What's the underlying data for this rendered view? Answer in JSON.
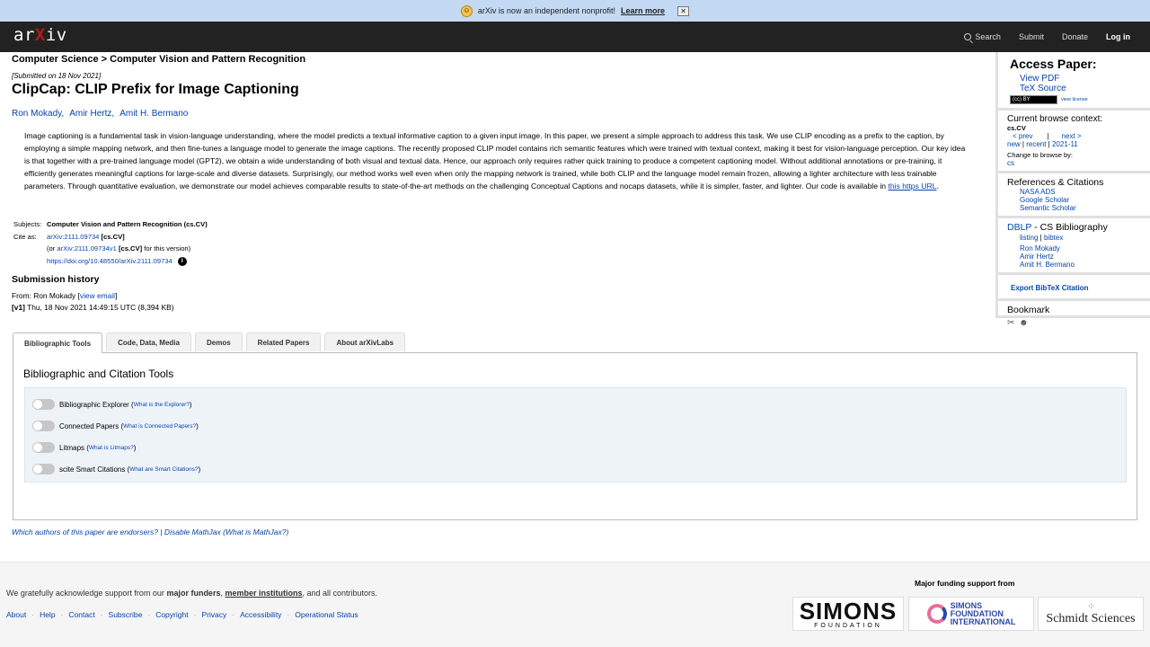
{
  "banner": {
    "text": "arXiv is now an independent nonprofit!",
    "link": "Learn more",
    "close": "✕"
  },
  "header": {
    "logo_pre": "ar",
    "logo_x": "X",
    "logo_post": "iv",
    "nav": {
      "search": "Search",
      "submit": "Submit",
      "donate": "Donate",
      "login": "Log in"
    }
  },
  "paper": {
    "breadcrumb": "Computer Science > Computer Vision and Pattern Recognition",
    "submitted": "[Submitted on 18 Nov 2021]",
    "title": "ClipCap: CLIP Prefix for Image Captioning",
    "authors": [
      "Ron Mokady,",
      "Amir Hertz,",
      "Amit H. Bermano"
    ],
    "abstract": "Image captioning is a fundamental task in vision-language understanding, where the model predicts a textual informative caption to a given input image. In this paper, we present a simple approach to address this task. We use CLIP encoding as a prefix to the caption, by employing a simple mapping network, and then fine-tunes a language model to generate the image captions. The recently proposed CLIP model contains rich semantic features which were trained with textual context, making it best for vision-language perception. Our key idea is that together with a pre-trained language model (GPT2), we obtain a wide understanding of both visual and textual data. Hence, our approach only requires rather quick training to produce a competent captioning model. Without additional annotations or pre-training, it efficiently generates meaningful captions for large-scale and diverse datasets. Surprisingly, our method works well even when only the mapping network is trained, while both CLIP and the language model remain frozen, allowing a lighter architecture with less trainable parameters. Through quantitative evaluation, we demonstrate our model achieves comparable results to state-of-the-art methods on the challenging Conceptual Captions and nocaps datasets, while it is simpler, faster, and lighter. Our code is available in",
    "abstract_link": "this https URL",
    "abstract_end": "."
  },
  "meta": {
    "subjects_label": "Subjects:",
    "subjects_value": "Computer Vision and Pattern Recognition (cs.CV)",
    "cite_label": "Cite as:",
    "cite_id": "arXiv:2111.09734",
    "cite_cat": "[cs.CV]",
    "version_pre": "(or",
    "version_id": "arXiv:2111.09734v1",
    "version_cat": "[cs.CV]",
    "version_post": "for this version)",
    "doi": "https://doi.org/10.48550/arXiv.2111.09734",
    "info": "i"
  },
  "history": {
    "heading": "Submission history",
    "from_label": "From: Ron Mokady [",
    "view_email": "view email",
    "from_end": "]",
    "version": "[v1]",
    "version_text": "Thu, 18 Nov 2021 14:49:15 UTC (8,394 KB)"
  },
  "sidebar": {
    "access_title": "Access Paper:",
    "view_pdf": "View PDF",
    "tex_source": "TeX Source",
    "cc_badge": "(cc) BY",
    "view_license": "view license",
    "context_title": "Current browse context:",
    "context_value": "cs.CV",
    "prev": "< prev",
    "sep": "|",
    "next": "next >",
    "new": "new",
    "recent": "recent",
    "month": "2021-11",
    "change_label": "Change to browse by:",
    "change_value": "cs",
    "refs_title": "References & Citations",
    "refs": [
      "NASA ADS",
      "Google Scholar",
      "Semantic Scholar"
    ],
    "dblp_link": "DBLP",
    "dblp_title": "- CS Bibliography",
    "listing": "listing",
    "bibtex": "bibtex",
    "dblp_authors": [
      "Ron Mokady",
      "Amir Hertz",
      "Amit H. Bermano"
    ],
    "export": "Export BibTeX Citation",
    "bookmark": "Bookmark"
  },
  "tabs": [
    "Bibliographic Tools",
    "Code, Data, Media",
    "Demos",
    "Related Papers",
    "About arXivLabs"
  ],
  "tools": {
    "heading": "Bibliographic and Citation Tools",
    "items": [
      {
        "label": "Bibliographic Explorer",
        "link": "What is the Explorer?"
      },
      {
        "label": "Connected Papers",
        "link": "What is Connected Papers?"
      },
      {
        "label": "Litmaps",
        "link": "What is Litmaps?"
      },
      {
        "label": "scite Smart Citations",
        "link": "What are Smart Citations?"
      }
    ]
  },
  "endorse": "Which authors of this paper are endorsers? | Disable MathJax (What is MathJax?)",
  "footer": {
    "ack_pre": "We gratefully acknowledge support from our",
    "major": "major funders",
    "member": "member institutions",
    "ack_post": ", and all contributors.",
    "funding_heading": "Major funding support from",
    "links": [
      "About",
      "Help",
      "Contact",
      "Subscribe",
      "Copyright",
      "Privacy",
      "Accessibility",
      "Operational Status"
    ],
    "simons_big": "SIMONS",
    "simons_small": "FOUNDATION",
    "sfi_1": "SIMONS",
    "sfi_2": "FOUNDATION",
    "sfi_3": "INTERNATIONAL",
    "schmidt": "Schmidt Sciences"
  },
  "colors": {
    "banner_bg": "#c4d9f3",
    "topbar_bg": "#222222",
    "link": "#0645ad",
    "arxiv_red": "#b31b1b"
  }
}
